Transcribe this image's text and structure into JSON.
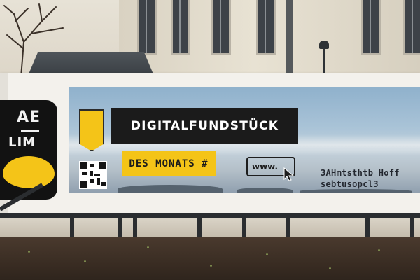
{
  "logo": {
    "line1": "AE",
    "line2": "LIM"
  },
  "banner": {
    "title": "DIGITALFUNDSTÜCK",
    "subtitle": "DES MONATS #",
    "url_label": "www.",
    "small_text": [
      "3AHmtsthtb Hoff",
      "sebtusopcl3"
    ]
  },
  "colors": {
    "accent_yellow": "#f4c418",
    "title_bg": "#1b1b1b",
    "banner_bg": "#f3f1ec"
  },
  "icons": [
    "shield-icon",
    "qr-code-icon",
    "cursor-icon"
  ]
}
